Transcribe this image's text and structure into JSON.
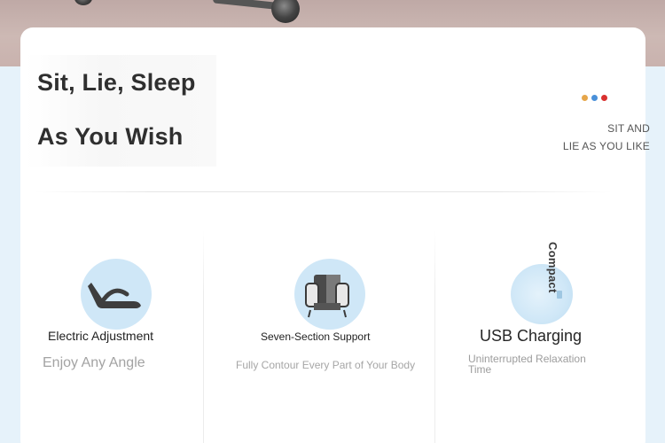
{
  "colors": {
    "background": "#e6f2fa",
    "card": "#ffffff",
    "icon_circle": "#cfe7f7",
    "dot_orange": "#e6a64a",
    "dot_blue": "#4a90d9",
    "dot_red": "#d9312f"
  },
  "hero": {
    "headline_line1": "Sit, Lie, Sleep",
    "headline_line2": "As You Wish",
    "side_line1": "SIT AND",
    "side_line2": "LIE AS YOU LIKE"
  },
  "features": [
    {
      "icon": "recline-chair-icon",
      "title": "Electric Adjustment",
      "subtitle": "Enjoy Any Angle"
    },
    {
      "icon": "armchair-icon",
      "title": "Seven-Section Support",
      "subtitle": "Fully Contour Every Part of Your Body"
    },
    {
      "icon": "usb-port-icon",
      "badge": "Compact",
      "title": "USB Charging",
      "subtitle": "Uninterrupted Relaxation Time"
    }
  ]
}
